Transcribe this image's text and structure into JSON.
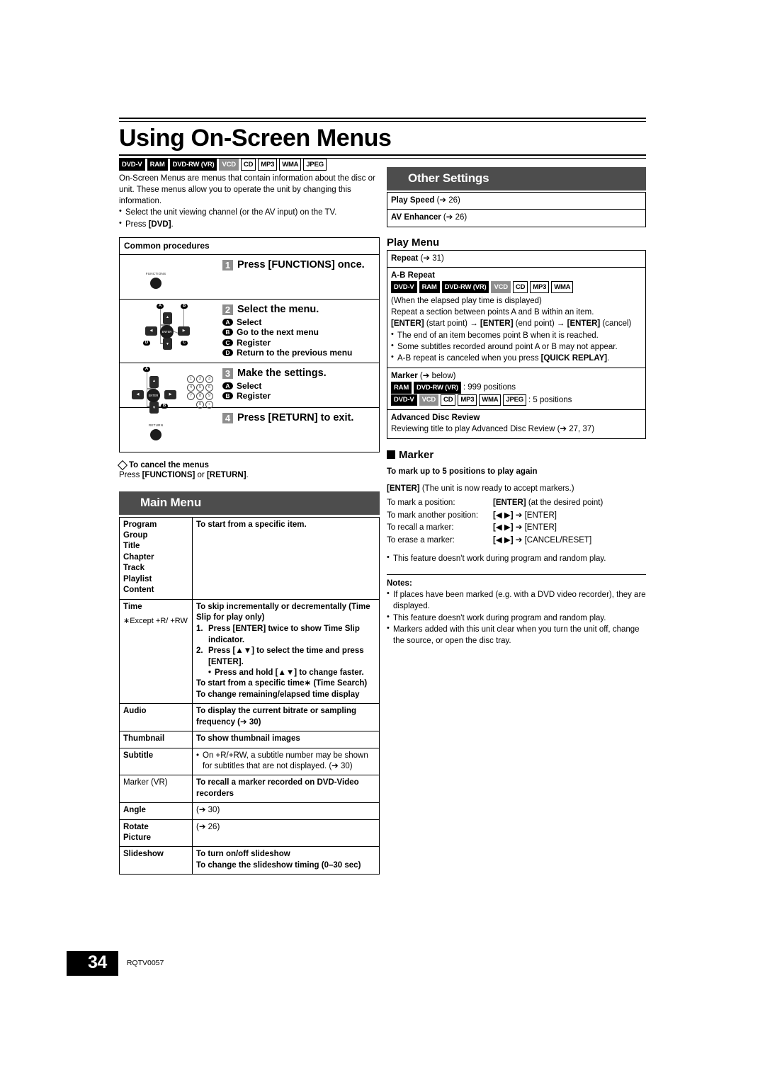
{
  "page": {
    "title": "Using On-Screen Menus",
    "footer_page_number": "34",
    "footer_code": "RQTV0057"
  },
  "intro": {
    "badges": [
      {
        "label": "DVD-V",
        "style": "black"
      },
      {
        "label": "RAM",
        "style": "black"
      },
      {
        "label": "DVD-RW (VR)",
        "style": "black"
      },
      {
        "label": "VCD",
        "style": "gray"
      },
      {
        "label": "CD",
        "style": "out"
      },
      {
        "label": "MP3",
        "style": "out"
      },
      {
        "label": "WMA",
        "style": "out"
      },
      {
        "label": "JPEG",
        "style": "out"
      }
    ],
    "paragraph": "On-Screen Menus are menus that contain information about the disc or unit. These menus allow you to operate the unit by changing this information.",
    "bullets": [
      "Select the unit viewing channel (or the AV input) on the TV.",
      "Press [DVD]."
    ]
  },
  "common_procedures": {
    "heading": "Common procedures",
    "steps": [
      {
        "number": "1",
        "label": "Press [FUNCTIONS] once.",
        "art": "functions-button",
        "button_caption": "FUNCTIONS",
        "sub": []
      },
      {
        "number": "2",
        "label": "Select the menu.",
        "art": "dpad-enter",
        "sub": [
          {
            "key": "A",
            "text": "Select"
          },
          {
            "key": "B",
            "text": "Go to the next menu"
          },
          {
            "key": "C",
            "text": "Register"
          },
          {
            "key": "D",
            "text": "Return to the previous menu"
          }
        ]
      },
      {
        "number": "3",
        "label": "Make the settings.",
        "art": "dpad-keypad",
        "keypad": [
          "1",
          "2",
          "3",
          "4",
          "5",
          "6",
          "7",
          "8",
          "9",
          "0",
          "÷"
        ],
        "sub": [
          {
            "key": "A",
            "text": "Select"
          },
          {
            "key": "B",
            "text": "Register"
          }
        ]
      },
      {
        "number": "4",
        "label": "Press [RETURN] to exit.",
        "art": "return-button",
        "button_caption": "RETURN",
        "sub": []
      }
    ],
    "enter_glyph": "ENTER"
  },
  "cancel_note": {
    "heading": "To cancel the menus",
    "text_parts": [
      "Press ",
      "[FUNCTIONS]",
      " or ",
      "[RETURN]",
      "."
    ]
  },
  "main_menu": {
    "bar_title": "Main Menu",
    "rows": [
      {
        "key_lines": [
          "Program",
          "Group",
          "Title",
          "Chapter",
          "Track",
          "Playlist",
          "Content"
        ],
        "value_html": "To start from a specific item.",
        "min_height": 108
      },
      {
        "key_lines": [
          "Time"
        ],
        "key_note": "∗Except +R/ +RW",
        "value_title": "To skip incrementally or decrementally (Time Slip for play only)",
        "steps": [
          {
            "n": "1.",
            "text": "Press [ENTER] twice to show Time Slip indicator."
          },
          {
            "n": "2.",
            "text": "Press [▲▼] to select the time and press [ENTER]."
          }
        ],
        "inner_bullet": "Press and hold [▲▼] to change faster.",
        "tail_lines": [
          "To start from a specific time∗ (Time Search)",
          "To change remaining/elapsed time display"
        ]
      },
      {
        "key_lines": [
          "Audio"
        ],
        "value_html": "To display the current bitrate or sampling frequency (➔ 30)"
      },
      {
        "key_lines": [
          "Thumbnail"
        ],
        "value_html": "To show thumbnail images"
      },
      {
        "key_lines": [
          "Subtitle"
        ],
        "value_bullet": "On +R/+RW, a subtitle number may be shown for subtitles that are not displayed. (➔ 30)"
      },
      {
        "key_lines": [
          "Marker (VR)"
        ],
        "key_weight": "normal",
        "value_html": "To recall a marker recorded on DVD-Video recorders"
      },
      {
        "key_lines": [
          "Angle"
        ],
        "value_html": "(➔ 30)",
        "value_weight": "normal"
      },
      {
        "key_lines": [
          "Rotate",
          "Picture"
        ],
        "value_html": "(➔ 26)",
        "value_weight": "normal"
      },
      {
        "key_lines": [
          "Slideshow"
        ],
        "value_lines": [
          "To turn on/off slideshow",
          "To change the slideshow timing (0–30 sec)"
        ]
      }
    ]
  },
  "other_settings": {
    "bar_title": "Other Settings",
    "rows": [
      {
        "label": "Play Speed",
        "ref": "(➔ 26)"
      },
      {
        "label": "AV Enhancer",
        "ref": "(➔ 26)"
      }
    ]
  },
  "play_menu": {
    "heading": "Play Menu",
    "repeat": {
      "label": "Repeat",
      "ref": "(➔ 31)"
    },
    "ab_repeat": {
      "title": "A-B Repeat",
      "badges": [
        {
          "label": "DVD-V",
          "style": "black"
        },
        {
          "label": "RAM",
          "style": "black"
        },
        {
          "label": "DVD-RW (VR)",
          "style": "black"
        },
        {
          "label": "VCD",
          "style": "gray"
        },
        {
          "label": "CD",
          "style": "out"
        },
        {
          "label": "MP3",
          "style": "out"
        },
        {
          "label": "WMA",
          "style": "out"
        }
      ],
      "lines": [
        "(When the elapsed play time is displayed)",
        "Repeat a section between points A and B within an item."
      ],
      "sequence": "[ENTER] (start point) → [ENTER] (end point) → [ENTER] (cancel)",
      "bullets": [
        "The end of an item becomes point B when it is reached.",
        "Some subtitles recorded around point A or B may not appear.",
        "A-B repeat is canceled when you press [QUICK REPLAY]."
      ]
    },
    "marker_row": {
      "title": "Marker",
      "ref": "(➔ below)",
      "lines": [
        {
          "badges": [
            {
              "label": "RAM",
              "style": "black"
            },
            {
              "label": "DVD-RW (VR)",
              "style": "black"
            }
          ],
          "text": ": 999 positions"
        },
        {
          "badges": [
            {
              "label": "DVD-V",
              "style": "black"
            },
            {
              "label": "VCD",
              "style": "gray"
            },
            {
              "label": "CD",
              "style": "out"
            },
            {
              "label": "MP3",
              "style": "out"
            },
            {
              "label": "WMA",
              "style": "out"
            },
            {
              "label": "JPEG",
              "style": "out"
            }
          ],
          "text": ": 5 positions"
        }
      ]
    },
    "advanced_disc_review": {
      "title": "Advanced Disc Review",
      "text": "Reviewing title to play Advanced Disc Review (➔ 27, 37)"
    }
  },
  "marker_section": {
    "heading": "Marker",
    "subheading": "To mark up to 5 positions to play again",
    "intro": "[ENTER] (The unit is now ready to accept markers.)",
    "lines": [
      {
        "label": "To mark a position:",
        "value": "[ENTER] (at the desired point)"
      },
      {
        "label": "To mark another position:",
        "value": "[◀ ▶] ➔ [ENTER]"
      },
      {
        "label": "To recall a marker:",
        "value": "[◀ ▶] ➔ [ENTER]"
      },
      {
        "label": "To erase a marker:",
        "value": "[◀ ▶] ➔ [CANCEL/RESET]"
      }
    ],
    "bullet": "This feature doesn't work during program and random play."
  },
  "notes": {
    "heading": "Notes:",
    "items": [
      "If places have been marked (e.g. with a DVD video recorder), they are displayed.",
      "This feature doesn't work during program and random play.",
      "Markers added with this unit clear when you turn the unit off, change the source, or open the disc tray."
    ]
  }
}
